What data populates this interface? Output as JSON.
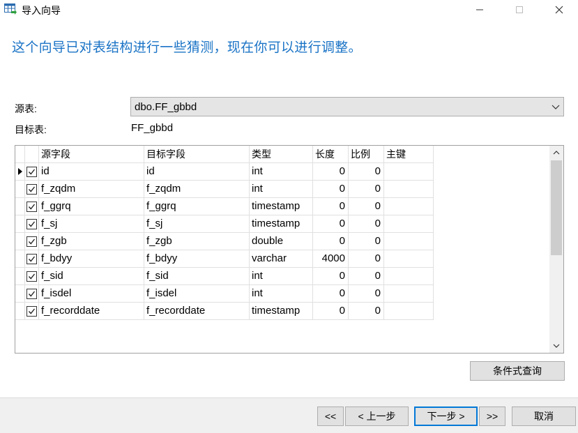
{
  "window": {
    "title": "导入向导",
    "min_glyph": "—",
    "max_glyph": "☐",
    "close_glyph": "✕"
  },
  "headline": "这个向导已对表结构进行一些猜测，现在你可以进行调整。",
  "source": {
    "label": "源表:",
    "value": "dbo.FF_gbbd"
  },
  "target": {
    "label": "目标表:",
    "value": "FF_gbbd"
  },
  "grid": {
    "headers": [
      "源字段",
      "目标字段",
      "类型",
      "长度",
      "比例",
      "主键"
    ],
    "rows": [
      {
        "checked": true,
        "src": "id",
        "tgt": "id",
        "type": "int",
        "len": "0",
        "scale": "0",
        "pk": ""
      },
      {
        "checked": true,
        "src": "f_zqdm",
        "tgt": "f_zqdm",
        "type": "int",
        "len": "0",
        "scale": "0",
        "pk": ""
      },
      {
        "checked": true,
        "src": "f_ggrq",
        "tgt": "f_ggrq",
        "type": "timestamp",
        "len": "0",
        "scale": "0",
        "pk": ""
      },
      {
        "checked": true,
        "src": "f_sj",
        "tgt": "f_sj",
        "type": "timestamp",
        "len": "0",
        "scale": "0",
        "pk": ""
      },
      {
        "checked": true,
        "src": "f_zgb",
        "tgt": "f_zgb",
        "type": "double",
        "len": "0",
        "scale": "0",
        "pk": ""
      },
      {
        "checked": true,
        "src": "f_bdyy",
        "tgt": "f_bdyy",
        "type": "varchar",
        "len": "4000",
        "scale": "0",
        "pk": ""
      },
      {
        "checked": true,
        "src": "f_sid",
        "tgt": "f_sid",
        "type": "int",
        "len": "0",
        "scale": "0",
        "pk": ""
      },
      {
        "checked": true,
        "src": "f_isdel",
        "tgt": "f_isdel",
        "type": "int",
        "len": "0",
        "scale": "0",
        "pk": ""
      },
      {
        "checked": true,
        "src": "f_recorddate",
        "tgt": "f_recorddate",
        "type": "timestamp",
        "len": "0",
        "scale": "0",
        "pk": ""
      }
    ]
  },
  "buttons": {
    "condition_query": "条件式查询",
    "first": "<<",
    "prev": "< 上一步",
    "next": "下一步 >",
    "last": ">>",
    "cancel": "取消"
  },
  "colors": {
    "headline": "#1a73c6",
    "focus_border": "#0078d7",
    "footer_bg": "#f0f0f0"
  }
}
